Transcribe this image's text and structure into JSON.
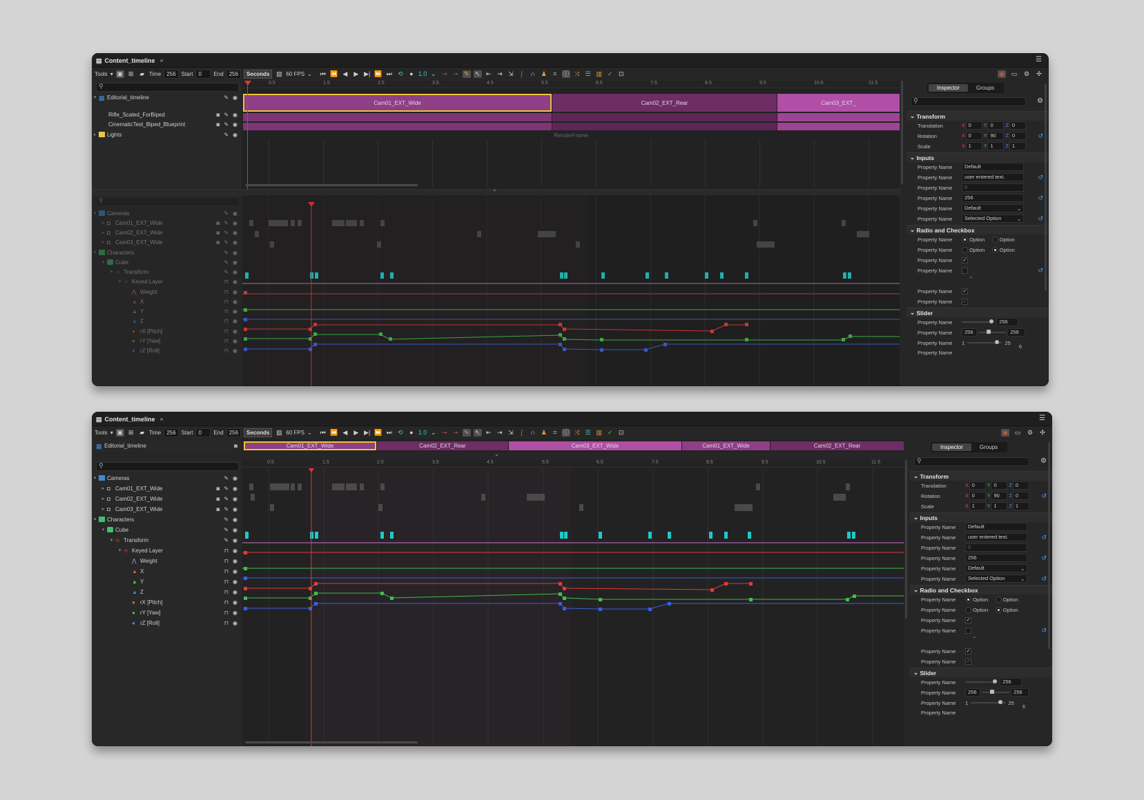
{
  "tab_title": "Content_timeline",
  "toolbar": {
    "tools_label": "Tools",
    "time_label": "Time",
    "time_value": "256",
    "start_label": "Start",
    "start_value": "0",
    "end_label": "End",
    "end_value": "256",
    "units_label": "Seconds",
    "fps_label": "60 FPS",
    "speed_label": "1.0"
  },
  "ruler_ticks": [
    "0.5",
    "1.5",
    "2.5",
    "3.5",
    "4.5",
    "5.5",
    "6.5",
    "7.5",
    "8.5",
    "9.5",
    "10.5",
    "11.5"
  ],
  "window1": {
    "editorial_track": "Editorial_timeline",
    "sub_tracks": [
      "Rifle_Scaled_ForBiped",
      "CinematicTest_Biped_Blueprint",
      "Lights"
    ],
    "clips": [
      "Cam01_EXT_Wide",
      "Cam02_EXT_Rear",
      "Cam03_EXT_"
    ],
    "renderframe": "RenderFrame"
  },
  "window2": {
    "editorial_track": "Editorial_timeline",
    "clips": [
      "Cam01_EXT_Wide",
      "Cam02_EXT_Rear",
      "Cam03_EXT_Wide",
      "Cam01_EXT_Wide",
      "Cam02_EXT_Rear"
    ]
  },
  "tree": {
    "cameras": "Cameras",
    "cam1": "Cam01_EXT_Wide",
    "cam2": "Cam02_EXT_Wide",
    "cam3": "Cam03_EXT_Wide",
    "characters": "Characters",
    "cube": "Cube",
    "transform": "Transform",
    "keyed_layer": "Keyed Layer",
    "weight": "Weight",
    "x": "X",
    "y": "Y",
    "z": "Z",
    "rx": "rX [Pitch]",
    "ry": "rY [Yaw]",
    "rz": "rZ [Roll]"
  },
  "inspector": {
    "tab_inspector": "Inspector",
    "tab_groups": "Groups",
    "transform": "Transform",
    "translation": "Translation",
    "rotation": "Rotation",
    "scale": "Scale",
    "axis_x": "X",
    "axis_y": "Y",
    "axis_z": "Z",
    "t_vals": [
      "0",
      "0",
      "0"
    ],
    "r_vals": [
      "0",
      "90",
      "0"
    ],
    "s_vals": [
      "1",
      "1",
      "1"
    ],
    "inputs": "Inputs",
    "prop": "Property Name",
    "in_default": "Default",
    "in_text": "user entered text.",
    "in_placeholder": "0",
    "in_num": "256",
    "dd_default": "Default",
    "dd_selected": "Selected Option",
    "radio_check": "Radio and Checkbox",
    "option": "Option",
    "slider": "Slider",
    "sl1": "256",
    "sl2a": "256",
    "sl2b": "256",
    "sl3a": "1",
    "sl3b": "25",
    "sl_small": "6"
  },
  "colors": {
    "clip_selected": "#8e3f86",
    "clip_a": "#6e2d64",
    "clip_b": "#b04fa5",
    "accent_yellow": "#f0c43a",
    "playhead": "#e0382b",
    "curve_red": "#e33b3b",
    "curve_green": "#3fbf4a",
    "curve_blue": "#3c5fe0",
    "key_cyan": "#20c8c8"
  }
}
